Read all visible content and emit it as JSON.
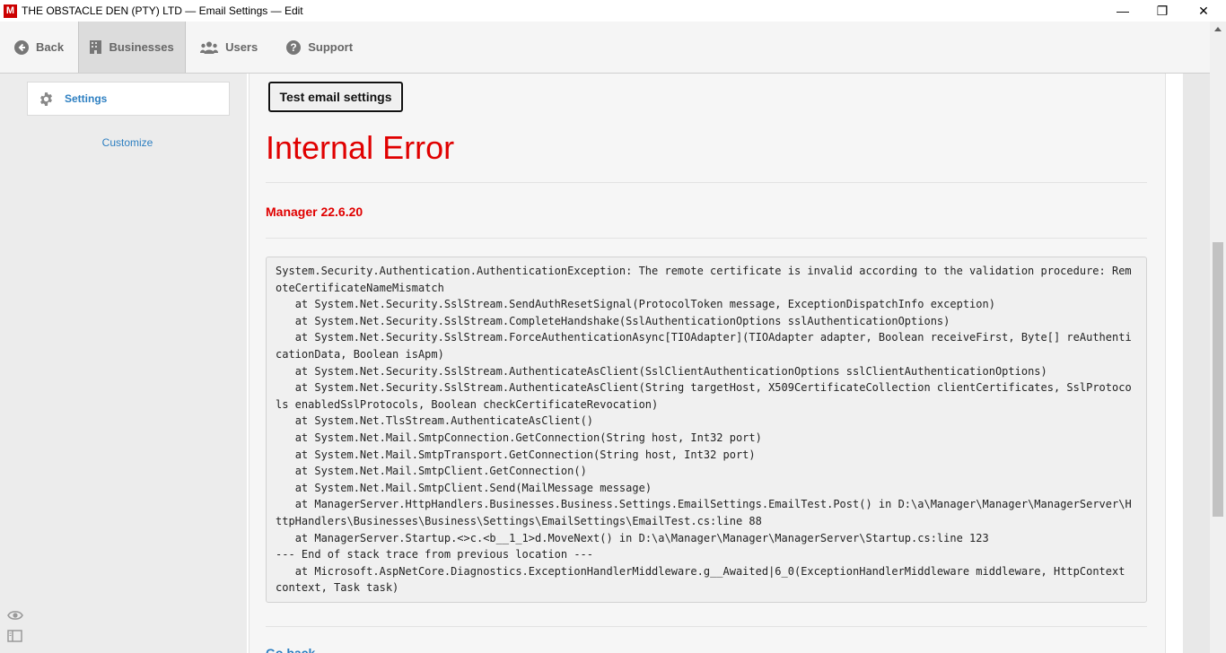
{
  "window": {
    "app_icon_letter": "M",
    "title": "THE OBSTACLE DEN (PTY) LTD — Email Settings — Edit",
    "minimize_glyph": "—",
    "maximize_glyph": "❐",
    "close_glyph": "✕"
  },
  "toolbar": {
    "back_label": "Back",
    "businesses_label": "Businesses",
    "users_label": "Users",
    "support_label": "Support"
  },
  "sidebar": {
    "settings_label": "Settings",
    "customize_label": "Customize"
  },
  "main": {
    "test_button_label": "Test email settings",
    "error_title": "Internal Error",
    "version": "Manager 22.6.20",
    "stack_trace": "System.Security.Authentication.AuthenticationException: The remote certificate is invalid according to the validation procedure: RemoteCertificateNameMismatch\n   at System.Net.Security.SslStream.SendAuthResetSignal(ProtocolToken message, ExceptionDispatchInfo exception)\n   at System.Net.Security.SslStream.CompleteHandshake(SslAuthenticationOptions sslAuthenticationOptions)\n   at System.Net.Security.SslStream.ForceAuthenticationAsync[TIOAdapter](TIOAdapter adapter, Boolean receiveFirst, Byte[] reAuthenticationData, Boolean isApm)\n   at System.Net.Security.SslStream.AuthenticateAsClient(SslClientAuthenticationOptions sslClientAuthenticationOptions)\n   at System.Net.Security.SslStream.AuthenticateAsClient(String targetHost, X509CertificateCollection clientCertificates, SslProtocols enabledSslProtocols, Boolean checkCertificateRevocation)\n   at System.Net.TlsStream.AuthenticateAsClient()\n   at System.Net.Mail.SmtpConnection.GetConnection(String host, Int32 port)\n   at System.Net.Mail.SmtpTransport.GetConnection(String host, Int32 port)\n   at System.Net.Mail.SmtpClient.GetConnection()\n   at System.Net.Mail.SmtpClient.Send(MailMessage message)\n   at ManagerServer.HttpHandlers.Businesses.Business.Settings.EmailSettings.EmailTest.Post() in D:\\a\\Manager\\Manager\\ManagerServer\\HttpHandlers\\Businesses\\Business\\Settings\\EmailSettings\\EmailTest.cs:line 88\n   at ManagerServer.Startup.<>c.<b__1_1>d.MoveNext() in D:\\a\\Manager\\Manager\\ManagerServer\\Startup.cs:line 123\n--- End of stack trace from previous location ---\n   at Microsoft.AspNetCore.Diagnostics.ExceptionHandlerMiddleware.g__Awaited|6_0(ExceptionHandlerMiddleware middleware, HttpContext context, Task task)",
    "go_back_label": "Go back"
  },
  "colors": {
    "error_red": "#e00000",
    "link_blue": "#2d7fc1",
    "brand_red": "#cc0000"
  }
}
